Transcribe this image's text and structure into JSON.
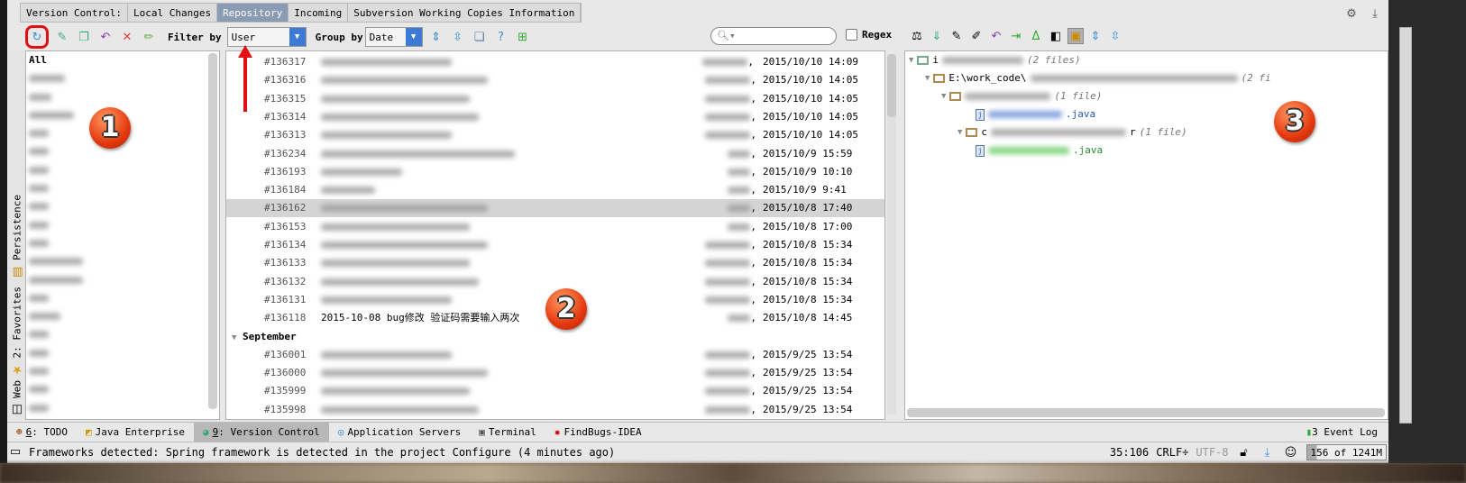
{
  "tabs": {
    "label": "Version Control:",
    "items": [
      "Local Changes",
      "Repository",
      "Incoming",
      "Subversion Working Copies Information"
    ],
    "active": 1
  },
  "toolbar": {
    "filter_label": "Filter by",
    "filter_value": "User",
    "group_label": "Group by",
    "group_value": "Date",
    "search_placeholder": "",
    "regex_label": "Regex",
    "regex_checked": false
  },
  "side_tools": {
    "persistence": "Persistence",
    "favorites": "2: Favorites",
    "web": "Web"
  },
  "users": {
    "all": "All",
    "blurred_count": 20
  },
  "commits": {
    "rows": [
      {
        "rev": "#136317",
        "date": "2015/10/10 14:09"
      },
      {
        "rev": "#136316",
        "date": "2015/10/10 14:05"
      },
      {
        "rev": "#136315",
        "date": "2015/10/10 14:05"
      },
      {
        "rev": "#136314",
        "date": "2015/10/10 14:05"
      },
      {
        "rev": "#136313",
        "date": "2015/10/10 14:05"
      },
      {
        "rev": "#136234",
        "date": "2015/10/9 15:59"
      },
      {
        "rev": "#136193",
        "date": "2015/10/9 10:10"
      },
      {
        "rev": "#136184",
        "date": "2015/10/9 9:41"
      },
      {
        "rev": "#136162",
        "date": "2015/10/8 17:40",
        "selected": true
      },
      {
        "rev": "#136153",
        "date": "2015/10/8 17:00"
      },
      {
        "rev": "#136134",
        "date": "2015/10/8 15:34"
      },
      {
        "rev": "#136133",
        "date": "2015/10/8 15:34"
      },
      {
        "rev": "#136132",
        "date": "2015/10/8 15:34"
      },
      {
        "rev": "#136131",
        "date": "2015/10/8 15:34"
      },
      {
        "rev": "#136118",
        "message": "2015-10-08 bug修改 验证码需要输入两次",
        "date": "2015/10/8 14:45"
      }
    ],
    "group": "September",
    "rows2": [
      {
        "rev": "#136001",
        "date": "2015/9/25 13:54"
      },
      {
        "rev": "#136000",
        "date": "2015/9/25 13:54"
      },
      {
        "rev": "#135999",
        "date": "2015/9/25 13:54"
      },
      {
        "rev": "#135998",
        "date": "2015/9/25 13:54"
      }
    ]
  },
  "files": {
    "root_prefix": "i",
    "root_count": "(2 files)",
    "path_prefix": "E:\\work_code\\",
    "path_count": "(2 fi",
    "dir1_count": "(1 file)",
    "file1_suffix": ".java",
    "dir2_prefix": "c",
    "dir2_suffix": "r",
    "dir2_count": "(1 file)",
    "file2_suffix": ".java"
  },
  "badges": [
    "1",
    "2",
    "3"
  ],
  "tool_tabs": [
    {
      "key": "6",
      "label": ": TODO"
    },
    {
      "key": "",
      "label": "Java Enterprise"
    },
    {
      "key": "9",
      "label": ": Version Control",
      "active": true
    },
    {
      "key": "",
      "label": "Application Servers"
    },
    {
      "key": "",
      "label": "Terminal"
    },
    {
      "key": "",
      "label": "FindBugs-IDEA"
    }
  ],
  "event_log": "3 Event Log",
  "status": {
    "message": "Frameworks detected: Spring framework is detected in the project Configure (4 minutes ago)",
    "position": "35:106",
    "line_sep": "CRLF÷",
    "encoding": "UTF-8",
    "memory": "156 of 1241M"
  },
  "colors": {
    "accent": "#3d7ad6",
    "highlight": "#e01010",
    "selected_row": "#d4d4d4",
    "active_tab": "#8a9bb4"
  }
}
